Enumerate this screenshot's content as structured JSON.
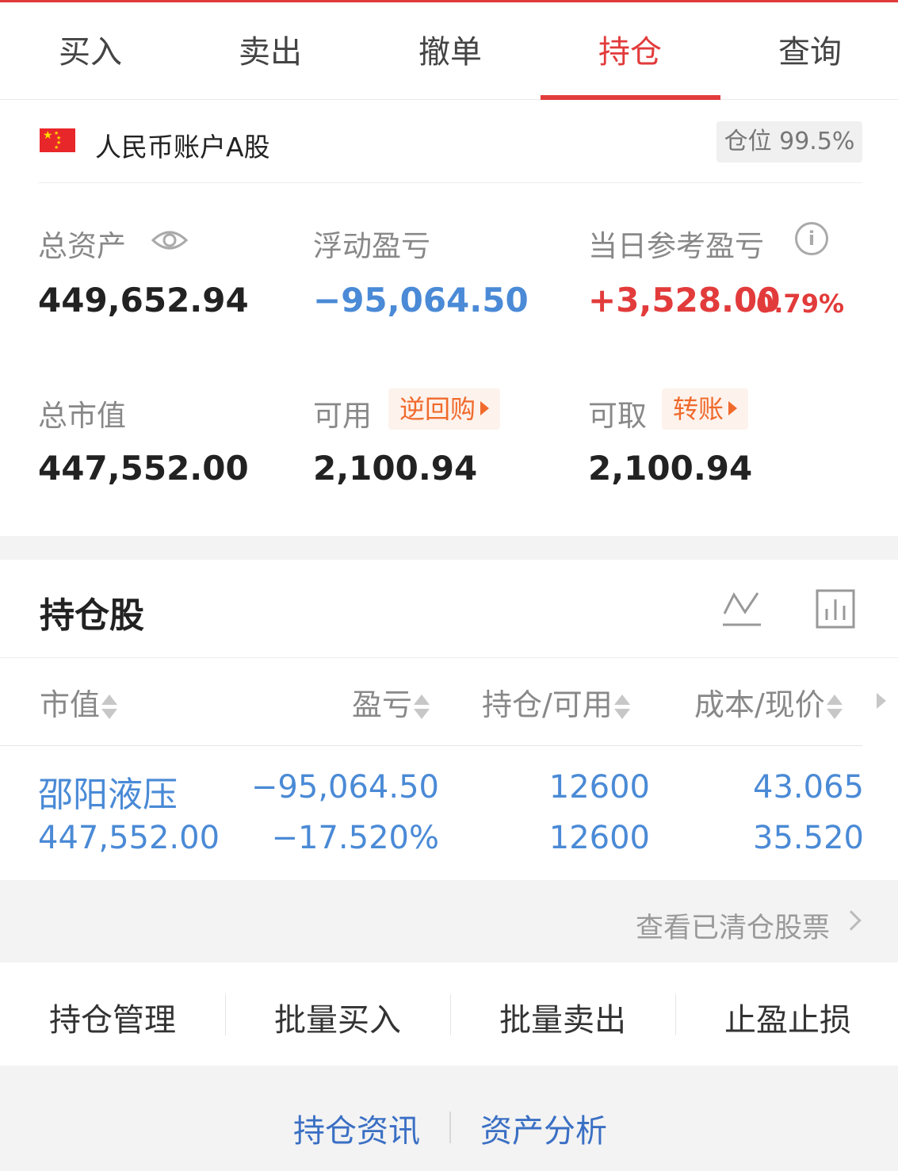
{
  "tabs": [
    {
      "label": "买入",
      "active": false
    },
    {
      "label": "卖出",
      "active": false
    },
    {
      "label": "撤单",
      "active": false
    },
    {
      "label": "持仓",
      "active": true
    },
    {
      "label": "查询",
      "active": false
    }
  ],
  "account": {
    "name": "人民币账户A股",
    "position_badge": "仓位 99.5%"
  },
  "stats": {
    "total_assets_label": "总资产",
    "total_assets": "449,652.94",
    "floating_pl_label": "浮动盈亏",
    "floating_pl": "−95,064.50",
    "daily_pl_label": "当日参考盈亏",
    "daily_pl": "+3,528.00",
    "daily_pl_pct": "0.79%",
    "market_value_label": "总市值",
    "market_value": "447,552.00",
    "available_label": "可用",
    "available": "2,100.94",
    "available_btn": "逆回购",
    "withdrawable_label": "可取",
    "withdrawable": "2,100.94",
    "withdrawable_btn": "转账"
  },
  "holdings": {
    "title": "持仓股",
    "columns": [
      "市值",
      "盈亏",
      "持仓/可用",
      "成本/现价"
    ],
    "rows": [
      {
        "name": "邵阳液压",
        "market_value": "447,552.00",
        "pl": "−95,064.50",
        "pl_pct": "−17.520%",
        "position": "12600",
        "available": "12600",
        "cost": "43.065",
        "price": "35.520"
      }
    ],
    "cleared_link": "查看已清仓股票"
  },
  "actions": [
    "持仓管理",
    "批量买入",
    "批量卖出",
    "止盈止损"
  ],
  "footer": [
    "持仓资讯",
    "资产分析"
  ],
  "colors": {
    "accent": "#e23b3b",
    "blue": "#4a8ad6",
    "orange": "#f06a2c",
    "link": "#3a6fc4"
  },
  "icons": [
    "eye-icon",
    "info-icon",
    "line-chart-icon",
    "bar-chart-icon",
    "chevron-right-icon"
  ]
}
